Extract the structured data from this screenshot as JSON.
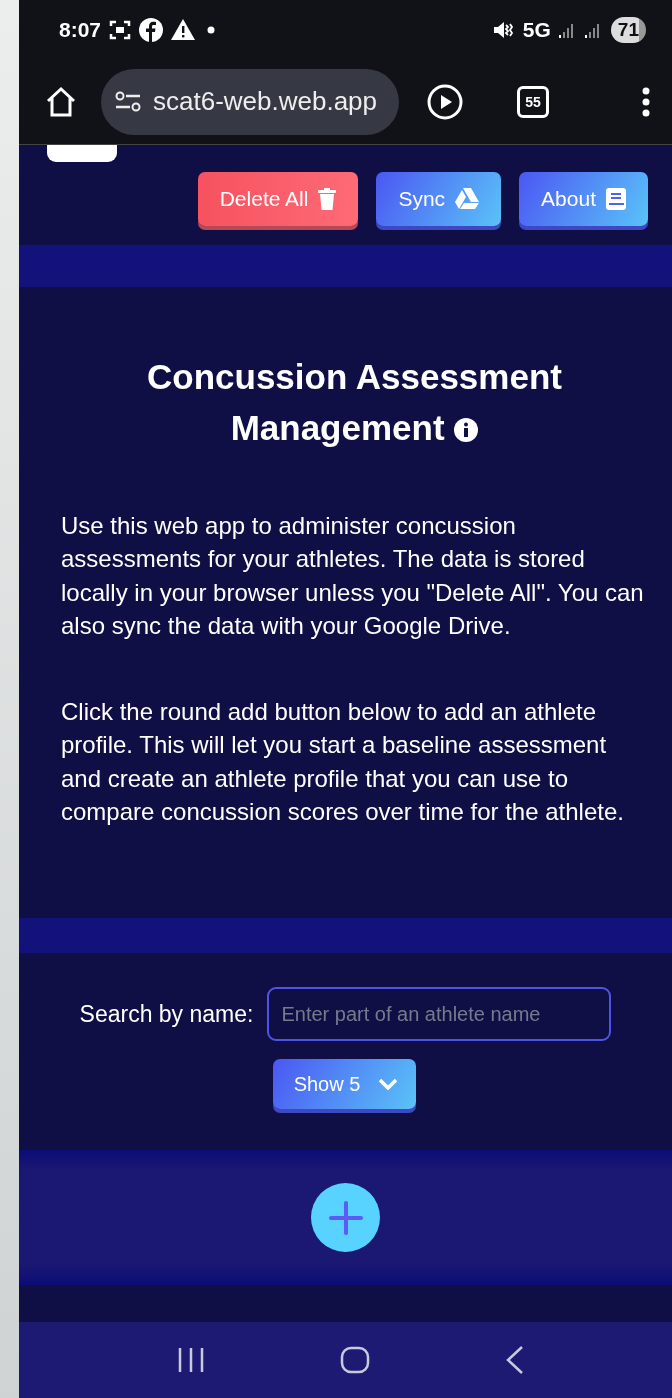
{
  "status_bar": {
    "time": "8:07",
    "network": "5G",
    "battery": "71"
  },
  "browser": {
    "url": "scat6-web.web.app",
    "tab_count": "55"
  },
  "header": {
    "buttons": [
      {
        "label": "Delete All",
        "kind": "danger"
      },
      {
        "label": "Sync",
        "kind": "primary"
      },
      {
        "label": "About",
        "kind": "primary"
      }
    ]
  },
  "intro": {
    "title": "Concussion Assessment Management",
    "paragraphs": [
      "Use this web app to administer concussion assessments for your athletes. The data is stored locally in your browser unless you \"Delete All\". You can also sync the data with your Google Drive.",
      "Click the round add button below to add an athlete profile. This will let you start a baseline assessment and create an athlete profile that you can use to compare concussion scores over time for the athlete."
    ]
  },
  "search": {
    "label": "Search by name:",
    "placeholder": "Enter part of an athlete name",
    "show_button": "Show 5"
  }
}
